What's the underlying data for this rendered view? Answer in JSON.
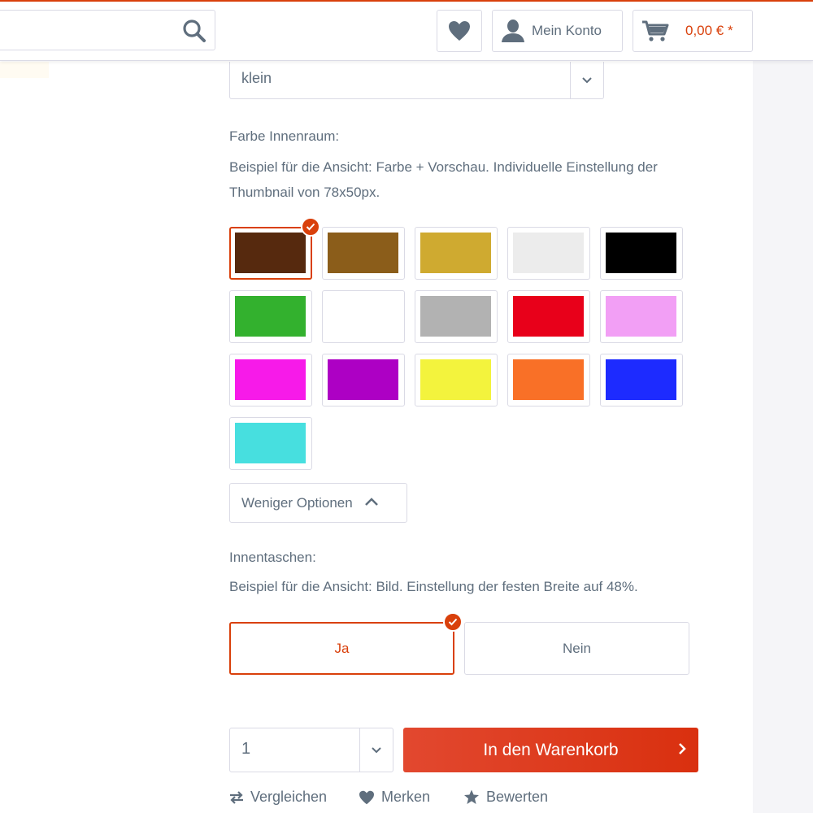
{
  "header": {
    "search_icon": "search-icon",
    "wishlist_icon": "heart-icon",
    "account_label": "Mein Konto",
    "account_icon": "user-icon",
    "cart_icon": "cart-icon",
    "cart_amount": "0,00 € *"
  },
  "size_select": {
    "value": "klein"
  },
  "interior": {
    "label": "Farbe Innenraum:",
    "description": "Beispiel für die Ansicht: Farbe + Vorschau. Individuelle Einstellung der Thumbnail von 78x50px.",
    "selected_index": 0,
    "swatches": [
      "#56290e",
      "#8b5d1a",
      "#cfaa30",
      "#ececec",
      "#000000",
      "#33b12e",
      "#ffffff",
      "#b2b2b2",
      "#e8001a",
      "#f29ff5",
      "#f71ae9",
      "#ad00c4",
      "#f3f33d",
      "#f97027",
      "#1d2bff",
      "#47dfdf"
    ]
  },
  "less_options_label": "Weniger Optionen",
  "pockets": {
    "label": "Innentaschen:",
    "description": "Beispiel für die Ansicht: Bild. Einstellung der festen Breite auf 48%.",
    "options": [
      "Ja",
      "Nein"
    ],
    "selected_index": 0
  },
  "quantity": {
    "value": "1"
  },
  "buy_button": "In den Warenkorb",
  "actions": {
    "compare": "Vergleichen",
    "remember": "Merken",
    "rate": "Bewerten"
  },
  "colors": {
    "accent": "#d9400b",
    "text": "#5f6e7d",
    "border": "#dadae5"
  }
}
